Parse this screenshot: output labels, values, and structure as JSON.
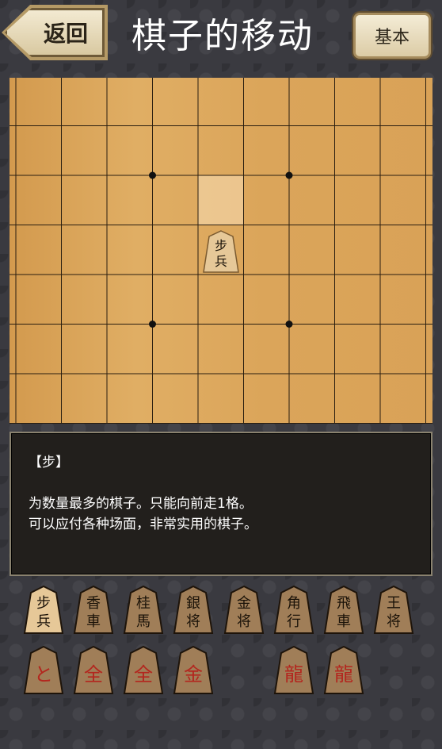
{
  "header": {
    "back_label": "返回",
    "title": "棋子的移动",
    "basic_label": "基本"
  },
  "board": {
    "files": 9,
    "ranks": 7,
    "highlight": {
      "file": 4,
      "rank": 2
    },
    "piece": {
      "file": 4,
      "rank": 3,
      "top": "步",
      "bottom": "兵"
    },
    "star_points": [
      [
        3,
        2
      ],
      [
        6,
        2
      ],
      [
        3,
        5
      ],
      [
        6,
        5
      ]
    ]
  },
  "info": {
    "name": "【步】",
    "line1": "为数量最多的棋子。只能向前走1格。",
    "line2": "可以应付各种场面，非常实用的棋子。"
  },
  "pieces_row1": [
    {
      "top": "步",
      "bottom": "兵",
      "selected": true
    },
    {
      "top": "香",
      "bottom": "車"
    },
    {
      "top": "桂",
      "bottom": "馬"
    },
    {
      "top": "銀",
      "bottom": "将"
    },
    {
      "top": "金",
      "bottom": "将"
    },
    {
      "top": "角",
      "bottom": "行"
    },
    {
      "top": "飛",
      "bottom": "車"
    },
    {
      "top": "王",
      "bottom": "将"
    }
  ],
  "pieces_row2": [
    {
      "char": "と"
    },
    {
      "char": "全"
    },
    {
      "char": "全"
    },
    {
      "char": "金"
    },
    {
      "char": "龍"
    },
    {
      "char": "龍"
    }
  ],
  "colors": {
    "board": "#dba55a",
    "promoted": "#b3261e",
    "piece_dark": "#a07e58",
    "piece_selected": "#e6c898"
  }
}
